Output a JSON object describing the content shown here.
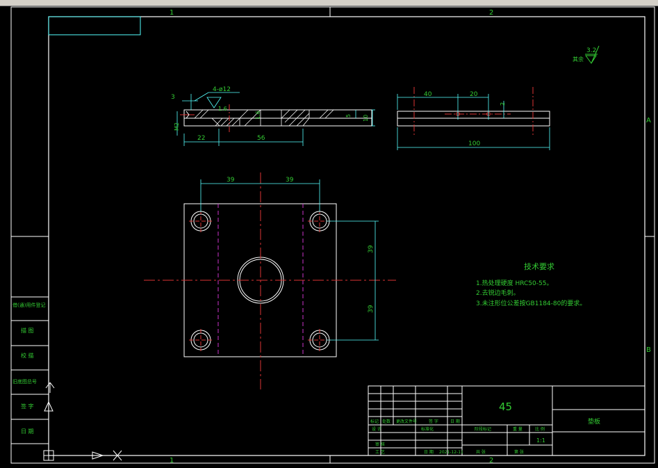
{
  "toolbar": {
    "items": [
      "",
      "",
      "",
      ""
    ]
  },
  "zones": {
    "top_1": "1",
    "top_2": "2",
    "bottom_1": "1",
    "bottom_2": "2",
    "right_a": "A",
    "right_b": "B"
  },
  "surface": {
    "method": "其余",
    "roughness": "3.2"
  },
  "dims": {
    "side_3": "3",
    "side_holes": "4-ø12",
    "side_rough1": "1.6",
    "side_rough2": "1.6",
    "side_m2": "M2",
    "side_22": "22",
    "side_56": "56",
    "side_5": "5",
    "side_10": "10",
    "edge_40": "40",
    "edge_20": "20",
    "edge_2": "2",
    "edge_100": "100",
    "plan_39a": "39",
    "plan_39b": "39",
    "plan_39c": "39",
    "plan_39d": "39"
  },
  "tech": {
    "title": "技术要求",
    "line1": "1.热处理硬度 HRC50-55。",
    "line2": "2.去锐边毛刺。",
    "line3": "3.未注形位公差按GB1184-80的要求。"
  },
  "side_table": {
    "row1": "借(通)用件登记",
    "row2": "描 图",
    "row3": "校 描",
    "row4": "旧底图总号",
    "row5": "签 字",
    "row6": "日 期"
  },
  "title_block": {
    "material": "45",
    "part_name": "垫板",
    "h_mark": "标记",
    "h_count": "处数",
    "h_zone": "更改文件号",
    "h_sign": "签 字",
    "h_date": "日 期",
    "designer": "设 计",
    "standard": "标准化",
    "checker": "审 核",
    "process": "工 艺",
    "date_label": "日 期",
    "date_value": "2021-12-11",
    "stage_mark": "阶段标记",
    "weight": "重 量",
    "scale": "比 例",
    "scale_value": "1:1",
    "sheets": "共 张",
    "sheet": "第 张"
  }
}
